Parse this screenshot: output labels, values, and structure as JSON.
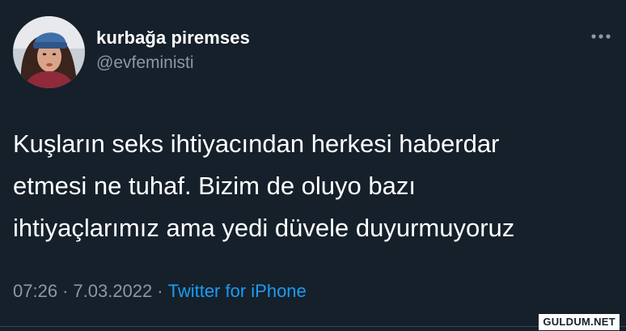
{
  "tweet": {
    "author": {
      "display_name": "kurbağa piremses",
      "handle": "@evfeministi",
      "avatar_icon": "user-avatar-photo"
    },
    "more_icon": "more-dots-icon",
    "text_lines": [
      "Kuşların seks ihtiyacından herkesi haberdar",
      "etmesi ne tuhaf. Bizim de oluyo bazı",
      "ihtiyaçlarımız ama yedi düvele duyurmuyoruz"
    ],
    "time": "07:26",
    "separator": "·",
    "date": "7.03.2022",
    "source": "Twitter for iPhone"
  },
  "watermark": "GULDUM.NET",
  "colors": {
    "background": "#15202b",
    "text": "#ffffff",
    "secondary_text": "#8b98a5",
    "link": "#1d9bf0",
    "divider": "#38444d"
  }
}
